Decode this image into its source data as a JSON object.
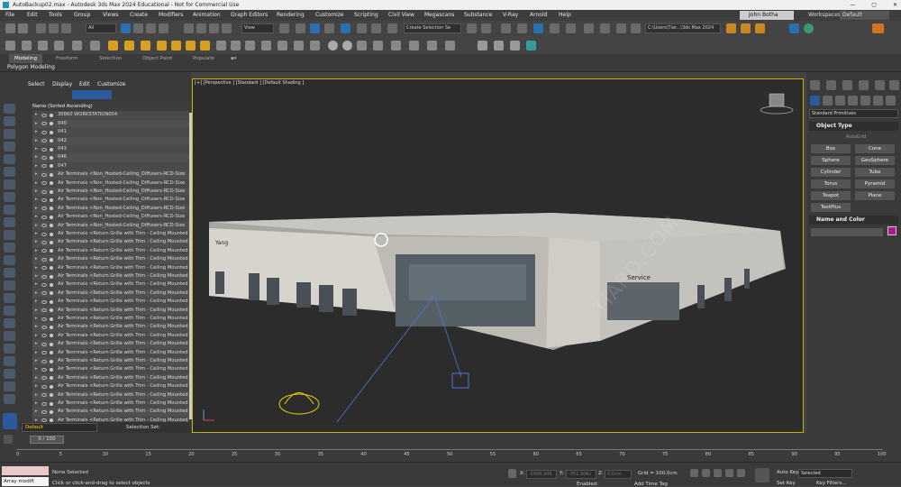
{
  "titlebar": {
    "title": "AutoBackup02.max - Autodesk 3ds Max 2024 Educational - Not for Commercial Use",
    "min": "—",
    "max": "▢",
    "close": "✕"
  },
  "menu": [
    "File",
    "Edit",
    "Tools",
    "Group",
    "Views",
    "Create",
    "Modifiers",
    "Animation",
    "Graph Editors",
    "Rendering",
    "Customize",
    "Scripting",
    "Civil View",
    "Megascans",
    "Substance",
    "V-Ray",
    "Arnold",
    "Help"
  ],
  "user": "John Botha",
  "workspace": {
    "label": "Workspaces:",
    "value": "Default"
  },
  "toolbar": {
    "filter": "All",
    "view": "View",
    "selection_set": "Create Selection Se",
    "path": "C:\\Users\\Tiar...\\3ds Max 2024"
  },
  "ribbon": {
    "tabs": [
      "Modeling",
      "Freeform",
      "Selection",
      "Object Paint",
      "Populate"
    ],
    "subtitle": "Polygon Modeling"
  },
  "explorer": {
    "menu": [
      "Select",
      "Display",
      "Edit",
      "Customize"
    ],
    "header": "Name (Sorted Ascending)",
    "rows": [
      "30860 WORKSTATION004",
      "040",
      "041",
      "042",
      "043",
      "046",
      "047",
      "Air Terminals <Non_Hosted-Ceiling_Diffusers-RCD-Size",
      "Air Terminals <Non_Hosted-Ceiling_Diffusers-RCD-Size",
      "Air Terminals <Non_Hosted-Ceiling_Diffusers-RCD-Size",
      "Air Terminals <Non_Hosted-Ceiling_Diffusers-RCD-Size",
      "Air Terminals <Non_Hosted-Ceiling_Diffusers-RCD-Size",
      "Air Terminals <Non_Hosted-Ceiling_Diffusers-RCD-Size",
      "Air Terminals <Non_Hosted-Ceiling_Diffusers-RCD-Size",
      "Air Terminals <Return Grille with Trim - Ceiling Mounted",
      "Air Terminals <Return Grille with Trim - Ceiling Mounted",
      "Air Terminals <Return Grille with Trim - Ceiling Mounted",
      "Air Terminals <Return Grille with Trim - Ceiling Mounted",
      "Air Terminals <Return Grille with Trim - Ceiling Mounted",
      "Air Terminals <Return Grille with Trim - Ceiling Mounted",
      "Air Terminals <Return Grille with Trim - Ceiling Mounted",
      "Air Terminals <Return Grille with Trim - Ceiling Mounted",
      "Air Terminals <Return Grille with Trim - Ceiling Mounted",
      "Air Terminals <Return Grille with Trim - Ceiling Mounted",
      "Air Terminals <Return Grille with Trim - Ceiling Mounted",
      "Air Terminals <Return Grille with Trim - Ceiling Mounted",
      "Air Terminals <Return Grille with Trim - Ceiling Mounted",
      "Air Terminals <Return Grille with Trim - Ceiling Mounted",
      "Air Terminals <Return Grille with Trim - Ceiling Mounted",
      "Air Terminals <Return Grille with Trim - Ceiling Mounted",
      "Air Terminals <Return Grille with Trim - Ceiling Mounted",
      "Air Terminals <Return Grille with Trim - Ceiling Mounted",
      "Air Terminals <Return Grille with Trim - Ceiling Mounted",
      "Air Terminals <Return Grille with Trim - Ceiling Mounted",
      "Air Terminals <Return Grille with Trim - Ceiling Mounted",
      "Air Terminals <Return Grille with Trim - Ceiling Mounted",
      "Air Terminals <Return Grille with Trim - Ceiling Mounted",
      "Air Terminals <Return Grille with Trim - Ceiling Mounted",
      "Air Terminals <Return Grille with Trim - Ceiling Mounted",
      "Air Terminals <Return Grille with Trim - Ceiling Mounted"
    ],
    "layer": "Default",
    "selection_set_label": "Selection Set:"
  },
  "viewport": {
    "label": "[+] [Perspective ] [Standard ] [Default Shading ]",
    "sign_service": "Service",
    "sign_yang": "Yang",
    "watermark": "TIARD.COM"
  },
  "command_panel": {
    "dropdown": "Standard Primitives",
    "object_type": "Object Type",
    "autogrid": "AutoGrid",
    "buttons": [
      "Box",
      "Cone",
      "Sphere",
      "GeoSphere",
      "Cylinder",
      "Tube",
      "Torus",
      "Pyramid",
      "Teapot",
      "Plane",
      "TextPlus"
    ],
    "name_and_color": "Name and Color"
  },
  "timeline": {
    "frame": "0 / 100",
    "ticks": [
      "0",
      "5",
      "10",
      "15",
      "20",
      "25",
      "30",
      "35",
      "40",
      "45",
      "50",
      "55",
      "60",
      "65",
      "70",
      "75",
      "80",
      "85",
      "90",
      "95",
      "100"
    ]
  },
  "status": {
    "maxscript": "Array modifi",
    "selected": "None Selected",
    "prompt": "Click or click-and-drag to select objects",
    "x_label": "X:",
    "x_val": "-5686.946",
    "y_label": "Y:",
    "y_val": "-951.306c",
    "z_label": "Z:",
    "z_val": "0.0cm",
    "grid": "Grid = 100.0cm",
    "enabled": "Enabled:",
    "add_time_tag": "Add Time Tag",
    "auto_key": "Auto Key",
    "set_key": "Set Key",
    "selected_dd": "Selected",
    "key_filters": "Key Filters..."
  },
  "colors": {
    "accent": "#c8b400",
    "selected": "#2a5a9a",
    "object_color": "#b0198a"
  }
}
